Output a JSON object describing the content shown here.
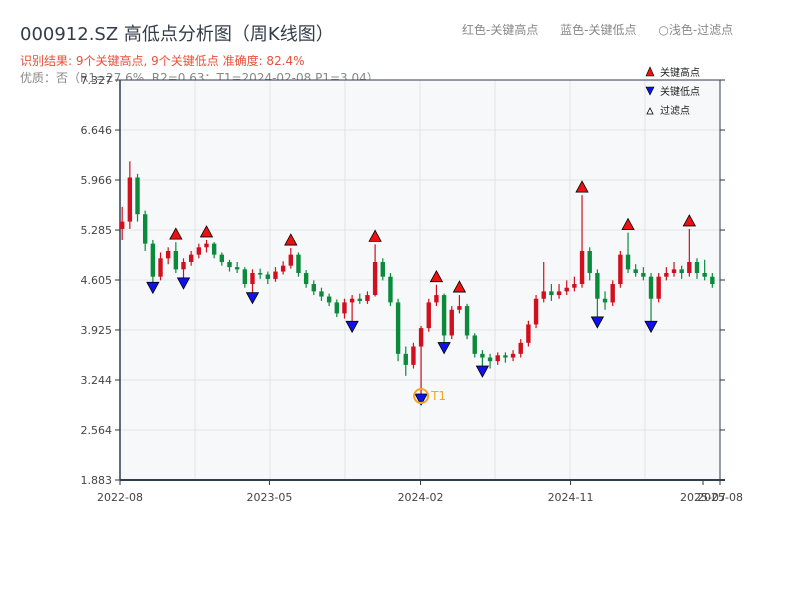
{
  "header": {
    "title": "000912.SZ 高低点分析图（周K线图）",
    "result_line": "识别结果: 9个关键高点, 9个关键低点  准确度: 82.4%",
    "quality_line": "优质：否（R1=27.6%, R2=0.63；T1=2024-02-08 P1=3.04）",
    "legend_top": [
      "红色-关键高点",
      "蓝色-关键低点",
      "○浅色-过滤点"
    ]
  },
  "colors": {
    "up": "#d0101e",
    "down": "#0b8a3c",
    "high_marker": "#ee1111",
    "low_marker": "#1111ee",
    "t1_ring": "#f5a623",
    "plot_bg": "#f6f8fa"
  },
  "chart_data": {
    "type": "candlestick",
    "title": "000912.SZ 高低点分析图（周K线图）",
    "ylim": [
      1.883,
      7.327
    ],
    "yticks": [
      1.883,
      2.564,
      3.244,
      3.925,
      4.605,
      5.285,
      5.966,
      6.646,
      7.327
    ],
    "xlim": [
      "2022-08-01",
      "2025-08-01"
    ],
    "xticks": [
      "2022-08",
      "2023-05",
      "2024-02",
      "2024-11",
      "2025-07",
      "2025-08"
    ],
    "grid": true,
    "legend": {
      "placement": "top-right",
      "entries": [
        "关键高点",
        "关键低点",
        "过滤点"
      ]
    },
    "candles": [
      [
        "2022-08-05",
        5.3,
        5.6,
        5.15,
        5.4
      ],
      [
        "2022-08-19",
        5.4,
        6.22,
        5.3,
        6.0
      ],
      [
        "2022-09-02",
        6.0,
        6.05,
        5.4,
        5.5
      ],
      [
        "2022-09-16",
        5.5,
        5.55,
        5.0,
        5.1
      ],
      [
        "2022-09-30",
        5.1,
        5.15,
        4.56,
        4.65
      ],
      [
        "2022-10-14",
        4.65,
        4.98,
        4.6,
        4.9
      ],
      [
        "2022-10-28",
        4.9,
        5.05,
        4.82,
        5.0
      ],
      [
        "2022-11-11",
        5.0,
        5.12,
        4.7,
        4.75
      ],
      [
        "2022-11-25",
        4.75,
        4.9,
        4.62,
        4.85
      ],
      [
        "2022-12-09",
        4.85,
        5.0,
        4.8,
        4.95
      ],
      [
        "2022-12-23",
        4.95,
        5.1,
        4.9,
        5.05
      ],
      [
        "2023-01-06",
        5.05,
        5.15,
        4.98,
        5.1
      ],
      [
        "2023-01-20",
        5.1,
        5.12,
        4.9,
        4.95
      ],
      [
        "2023-02-03",
        4.95,
        4.98,
        4.8,
        4.85
      ],
      [
        "2023-02-17",
        4.85,
        4.88,
        4.72,
        4.78
      ],
      [
        "2023-03-03",
        4.78,
        4.85,
        4.7,
        4.75
      ],
      [
        "2023-03-17",
        4.75,
        4.78,
        4.5,
        4.55
      ],
      [
        "2023-03-31",
        4.55,
        4.75,
        4.42,
        4.7
      ],
      [
        "2023-04-14",
        4.7,
        4.76,
        4.62,
        4.68
      ],
      [
        "2023-04-28",
        4.68,
        4.72,
        4.55,
        4.62
      ],
      [
        "2023-05-12",
        4.62,
        4.78,
        4.58,
        4.72
      ],
      [
        "2023-05-26",
        4.72,
        4.86,
        4.68,
        4.8
      ],
      [
        "2023-06-09",
        4.8,
        5.04,
        4.76,
        4.95
      ],
      [
        "2023-06-23",
        4.95,
        4.98,
        4.65,
        4.7
      ],
      [
        "2023-07-07",
        4.7,
        4.74,
        4.5,
        4.55
      ],
      [
        "2023-07-21",
        4.55,
        4.6,
        4.4,
        4.45
      ],
      [
        "2023-08-04",
        4.45,
        4.5,
        4.32,
        4.38
      ],
      [
        "2023-08-18",
        4.38,
        4.42,
        4.25,
        4.3
      ],
      [
        "2023-09-01",
        4.3,
        4.34,
        4.1,
        4.15
      ],
      [
        "2023-09-15",
        4.15,
        4.35,
        4.08,
        4.3
      ],
      [
        "2023-09-29",
        4.3,
        4.4,
        4.03,
        4.35
      ],
      [
        "2023-10-13",
        4.35,
        4.42,
        4.28,
        4.32
      ],
      [
        "2023-10-27",
        4.32,
        4.45,
        4.28,
        4.4
      ],
      [
        "2023-11-10",
        4.4,
        5.09,
        4.38,
        4.85
      ],
      [
        "2023-11-24",
        4.85,
        4.9,
        4.6,
        4.65
      ],
      [
        "2023-12-08",
        4.65,
        4.7,
        4.25,
        4.3
      ],
      [
        "2023-12-22",
        4.3,
        4.35,
        3.5,
        3.6
      ],
      [
        "2024-01-05",
        3.6,
        3.7,
        3.3,
        3.45
      ],
      [
        "2024-01-19",
        3.45,
        3.75,
        3.4,
        3.7
      ],
      [
        "2024-02-02",
        3.7,
        3.98,
        3.04,
        3.95
      ],
      [
        "2024-02-16",
        3.95,
        4.35,
        3.9,
        4.3
      ],
      [
        "2024-03-01",
        4.3,
        4.54,
        4.25,
        4.4
      ],
      [
        "2024-03-15",
        4.4,
        4.42,
        3.74,
        3.85
      ],
      [
        "2024-03-29",
        3.85,
        4.25,
        3.8,
        4.2
      ],
      [
        "2024-04-12",
        4.2,
        4.4,
        4.15,
        4.25
      ],
      [
        "2024-04-26",
        4.25,
        4.28,
        3.8,
        3.85
      ],
      [
        "2024-05-10",
        3.85,
        3.88,
        3.55,
        3.6
      ],
      [
        "2024-05-24",
        3.6,
        3.65,
        3.42,
        3.55
      ],
      [
        "2024-06-07",
        3.55,
        3.6,
        3.4,
        3.5
      ],
      [
        "2024-06-21",
        3.5,
        3.62,
        3.45,
        3.58
      ],
      [
        "2024-07-05",
        3.58,
        3.62,
        3.48,
        3.55
      ],
      [
        "2024-07-19",
        3.55,
        3.65,
        3.5,
        3.6
      ],
      [
        "2024-08-02",
        3.6,
        3.8,
        3.55,
        3.75
      ],
      [
        "2024-08-16",
        3.75,
        4.05,
        3.7,
        4.0
      ],
      [
        "2024-08-30",
        4.0,
        4.4,
        3.95,
        4.35
      ],
      [
        "2024-09-13",
        4.35,
        4.85,
        4.3,
        4.45
      ],
      [
        "2024-09-27",
        4.45,
        4.55,
        4.32,
        4.4
      ],
      [
        "2024-10-11",
        4.4,
        4.55,
        4.35,
        4.45
      ],
      [
        "2024-10-25",
        4.45,
        4.6,
        4.4,
        4.5
      ],
      [
        "2024-11-08",
        4.5,
        4.65,
        4.45,
        4.55
      ],
      [
        "2024-11-22",
        4.55,
        5.76,
        4.5,
        5.0
      ],
      [
        "2024-12-06",
        5.0,
        5.05,
        4.6,
        4.7
      ],
      [
        "2024-12-20",
        4.7,
        4.75,
        4.09,
        4.35
      ],
      [
        "2025-01-03",
        4.35,
        4.45,
        4.2,
        4.3
      ],
      [
        "2025-01-17",
        4.3,
        4.6,
        4.25,
        4.55
      ],
      [
        "2025-01-31",
        4.55,
        5.0,
        4.5,
        4.95
      ],
      [
        "2025-02-14",
        4.95,
        5.25,
        4.7,
        4.75
      ],
      [
        "2025-02-28",
        4.75,
        4.82,
        4.65,
        4.7
      ],
      [
        "2025-03-14",
        4.7,
        4.78,
        4.6,
        4.65
      ],
      [
        "2025-03-28",
        4.65,
        4.7,
        4.03,
        4.35
      ],
      [
        "2025-04-11",
        4.35,
        4.7,
        4.3,
        4.65
      ],
      [
        "2025-04-25",
        4.65,
        4.78,
        4.6,
        4.7
      ],
      [
        "2025-05-09",
        4.7,
        4.85,
        4.65,
        4.75
      ],
      [
        "2025-05-23",
        4.75,
        4.8,
        4.62,
        4.7
      ],
      [
        "2025-06-06",
        4.7,
        5.3,
        4.65,
        4.85
      ],
      [
        "2025-06-20",
        4.85,
        4.9,
        4.62,
        4.7
      ],
      [
        "2025-07-04",
        4.7,
        4.88,
        4.6,
        4.65
      ],
      [
        "2025-07-18",
        4.65,
        4.7,
        4.5,
        4.55
      ]
    ],
    "key_highs": [
      [
        "2022-11-11",
        5.12
      ],
      [
        "2023-01-06",
        5.15
      ],
      [
        "2023-06-09",
        5.04
      ],
      [
        "2023-11-10",
        5.09
      ],
      [
        "2024-03-01",
        4.54
      ],
      [
        "2024-04-12",
        4.4
      ],
      [
        "2024-11-22",
        5.76
      ],
      [
        "2025-02-14",
        5.25
      ],
      [
        "2025-06-06",
        5.3
      ]
    ],
    "key_lows": [
      [
        "2022-09-30",
        4.56
      ],
      [
        "2022-11-25",
        4.62
      ],
      [
        "2023-03-31",
        4.42
      ],
      [
        "2023-09-29",
        4.03
      ],
      [
        "2024-02-02",
        3.04
      ],
      [
        "2024-03-15",
        3.74
      ],
      [
        "2024-05-24",
        3.42
      ],
      [
        "2024-12-20",
        4.09
      ],
      [
        "2025-03-28",
        4.03
      ]
    ],
    "annotations": [
      {
        "label": "T1",
        "date": "2024-02-02",
        "price": 3.04
      }
    ]
  }
}
